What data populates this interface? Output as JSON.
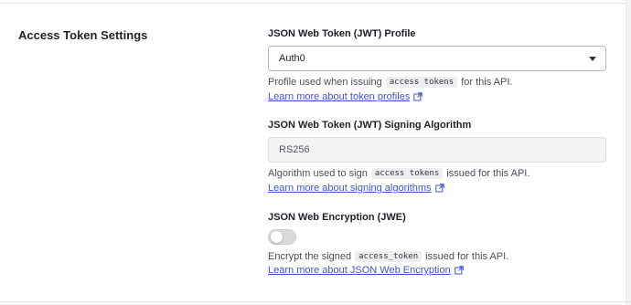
{
  "section": {
    "title": "Access Token Settings"
  },
  "jwt_profile": {
    "label": "JSON Web Token (JWT) Profile",
    "selected": "Auth0",
    "help_prefix": "Profile used when issuing",
    "help_code": "access tokens",
    "help_suffix": "for this API.",
    "link": "Learn more about token profiles"
  },
  "signing_algorithm": {
    "label": "JSON Web Token (JWT) Signing Algorithm",
    "value": "RS256",
    "help_prefix": "Algorithm used to sign",
    "help_code": "access tokens",
    "help_suffix": "issued for this API.",
    "link": "Learn more about signing algorithms"
  },
  "jwe": {
    "label": "JSON Web Encryption (JWE)",
    "enabled": false,
    "help_prefix": "Encrypt the signed",
    "help_code": "access_token",
    "help_suffix": "issued for this API.",
    "link": "Learn more about JSON Web Encryption"
  },
  "colors": {
    "link": "#3d54d8",
    "text": "#1e212a",
    "code_bg": "#eeeef0"
  },
  "icons": {
    "external_link": "external-link-icon",
    "dropdown": "chevron-down-icon"
  }
}
